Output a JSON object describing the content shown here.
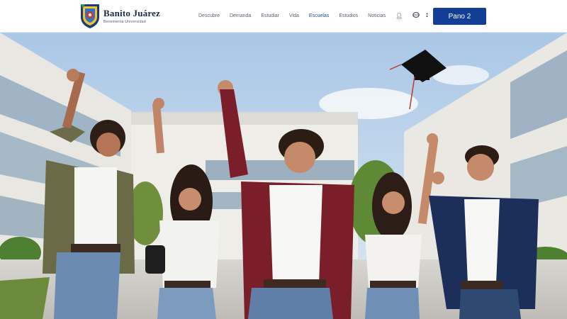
{
  "brand": {
    "name": "Banito Juárez",
    "tagline": "Benemérita Universidad"
  },
  "nav": {
    "items": [
      {
        "label": "Descubre"
      },
      {
        "label": "Demanda"
      },
      {
        "label": "Estudiar"
      },
      {
        "label": "Vida"
      },
      {
        "label": "Escuelas",
        "active": true
      },
      {
        "label": "Estudios"
      },
      {
        "label": "Noticias"
      }
    ],
    "icons": [
      "user-icon",
      "globe-icon",
      "chevron-down-icon"
    ]
  },
  "cta": {
    "label": "Pano 2"
  },
  "colors": {
    "accent": "#133e95",
    "nav_active": "#1f4fa0",
    "sky": "#bcd3ea",
    "building": "#ecebe6",
    "maroon_blazer": "#7a1e2a",
    "navy_blazer": "#1c2f5a"
  },
  "hero": {
    "image": "students-celebrating-campus-photo"
  }
}
